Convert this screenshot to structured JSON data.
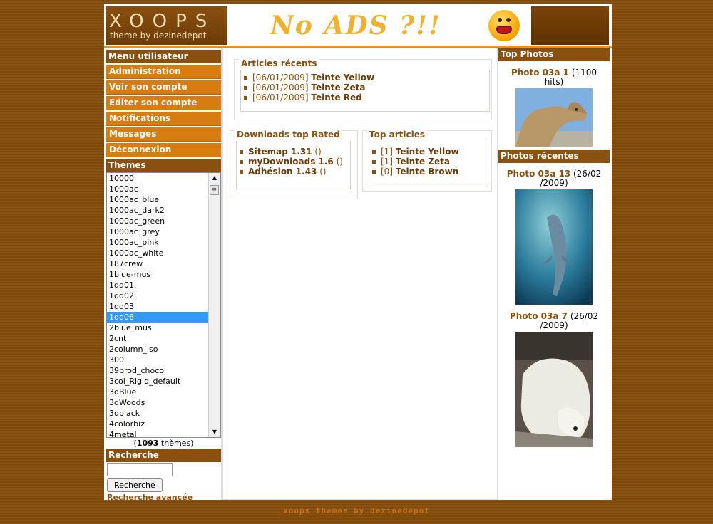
{
  "header": {
    "logo_title": "XOOPS",
    "logo_subtitle": "theme by dezinedepot",
    "banner_text": "No ADS ?!!"
  },
  "left": {
    "user_menu_title": "Menu utilisateur",
    "menu_items": [
      "Administration",
      "Voir son compte",
      "Editer son compte",
      "Notifications",
      "Messages",
      "Déconnexion"
    ],
    "themes_title": "Themes",
    "themes": [
      "10000",
      "1000ac",
      "1000ac_blue",
      "1000ac_dark2",
      "1000ac_green",
      "1000ac_grey",
      "1000ac_pink",
      "1000ac_white",
      "187crew",
      "1blue-mus",
      "1dd01",
      "1dd02",
      "1dd03",
      "1dd06",
      "2blue_mus",
      "2cnt",
      "2column_iso",
      "300",
      "39prod_choco",
      "3col_Rigid_default",
      "3dBlue",
      "3dWoods",
      "3dblack",
      "4colorbiz",
      "4metal"
    ],
    "selected_theme": "1dd06",
    "themes_count_open": "(",
    "themes_count": "1093",
    "themes_count_label": " thèmes)",
    "search_title": "Recherche",
    "search_value": "",
    "search_button": "Recherche",
    "advanced_search": "Recherche avancée"
  },
  "center": {
    "recent_title": "Articles récents",
    "recent": [
      {
        "date": "[06/01/2009]",
        "title": "Teinte Yellow"
      },
      {
        "date": "[06/01/2009]",
        "title": "Teinte Zeta"
      },
      {
        "date": "[06/01/2009]",
        "title": "Teinte Red"
      }
    ],
    "downloads_title": "Downloads top Rated",
    "downloads": [
      {
        "name": "Sitemap 1.31",
        "extra": " ()"
      },
      {
        "name": "myDownloads 1.6",
        "extra": " ()"
      },
      {
        "name": "Adhésion 1.43",
        "extra": " ()"
      }
    ],
    "top_title": "Top articles",
    "top": [
      {
        "count": "[1]",
        "title": "Teinte Yellow"
      },
      {
        "count": "[1]",
        "title": "Teinte Zeta"
      },
      {
        "count": "[0]",
        "title": "Teinte Brown"
      }
    ]
  },
  "right": {
    "top_photos_title": "Top Photos",
    "top_photo_name": "Photo 03a 1",
    "top_photo_info": " (1100 hits)",
    "recent_title": "Photos récentes",
    "recent": [
      {
        "name": "Photo 03a 13",
        "info": " (26/02 /2009)"
      },
      {
        "name": "Photo 03a 7",
        "info": " (26/02 /2009)"
      }
    ]
  },
  "footer": {
    "text": "xoops themes by dezinedepot"
  },
  "colors": {
    "brown": "#8a5010",
    "orange": "#d87c10",
    "selection": "#3399ff"
  }
}
